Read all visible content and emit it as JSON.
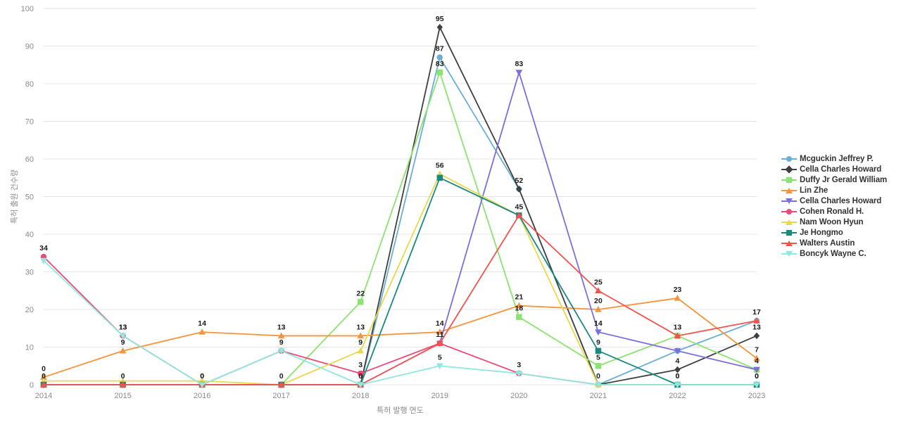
{
  "chart_data": {
    "type": "line",
    "title": "",
    "xlabel": "특허 발행 연도",
    "ylabel": "특허 출원 건수량",
    "categories": [
      "2014",
      "2015",
      "2016",
      "2017",
      "2018",
      "2019",
      "2020",
      "2021",
      "2022",
      "2023"
    ],
    "x": [
      2014,
      2015,
      2016,
      2017,
      2018,
      2019,
      2020,
      2021,
      2022,
      2023
    ],
    "ylim": [
      0,
      100
    ],
    "yticks": [
      0,
      10,
      20,
      30,
      40,
      50,
      60,
      70,
      80,
      90,
      100
    ],
    "grid": true,
    "legend_position": "right",
    "series": [
      {
        "name": "Mcguckin Jeffrey P.",
        "color": "#6BAED6",
        "marker": "circle",
        "values": [
          0,
          0,
          0,
          0,
          0,
          87,
          52,
          0,
          9,
          17
        ],
        "labels": [
          "",
          "",
          "",
          "",
          "",
          "87",
          "52",
          "",
          "",
          "17"
        ]
      },
      {
        "name": "Cella Charles Howard",
        "color": "#3F3F3F",
        "marker": "diamond",
        "values": [
          0,
          0,
          0,
          0,
          0,
          95,
          52,
          0,
          4,
          13
        ],
        "labels": [
          "",
          "",
          "",
          "",
          "",
          "95",
          "",
          "",
          "4",
          "13"
        ]
      },
      {
        "name": "Duffy Jr Gerald William",
        "color": "#8BE370",
        "marker": "square",
        "values": [
          0,
          0,
          0,
          0,
          22,
          83,
          18,
          5,
          13,
          4
        ],
        "labels": [
          "",
          "",
          "",
          "",
          "22",
          "83",
          "18",
          "5",
          "13",
          "4"
        ]
      },
      {
        "name": "Lin Zhe",
        "color": "#F5943B",
        "marker": "triangle",
        "values": [
          2,
          9,
          14,
          13,
          13,
          14,
          21,
          20,
          23,
          7
        ],
        "labels": [
          "0",
          "9",
          "14",
          "13",
          "13",
          "14",
          "21",
          "20",
          "23",
          "7"
        ]
      },
      {
        "name": "Cella Charles Howard",
        "color": "#7B6FE0",
        "marker": "triangle-down",
        "values": [
          0,
          0,
          0,
          0,
          0,
          11,
          83,
          14,
          9,
          4
        ],
        "labels": [
          "",
          "",
          "",
          "",
          "",
          "",
          "83",
          "14",
          "",
          ""
        ]
      },
      {
        "name": "Cohen Ronald H.",
        "color": "#EE4877",
        "marker": "circle",
        "values": [
          34,
          13,
          0,
          9,
          3,
          11,
          3,
          0,
          0,
          0
        ],
        "labels": [
          "34",
          "13",
          "0",
          "9",
          "3",
          "11",
          "3",
          "0",
          "0",
          "0"
        ]
      },
      {
        "name": "Nam Woon Hyun",
        "color": "#E8D84B",
        "marker": "triangle",
        "values": [
          1,
          1,
          1,
          0,
          9,
          56,
          45,
          0,
          0,
          0
        ],
        "labels": [
          "",
          "",
          "",
          "",
          "9",
          "56",
          "",
          "",
          "",
          ""
        ]
      },
      {
        "name": "Je Hongmo",
        "color": "#188A7F",
        "marker": "square",
        "values": [
          0,
          0,
          0,
          0,
          0,
          55,
          45,
          9,
          0,
          0
        ],
        "labels": [
          "0",
          "0",
          "0",
          "0",
          "0",
          "",
          "45",
          "9",
          "0",
          "0"
        ]
      },
      {
        "name": "Walters Austin",
        "color": "#F4534D",
        "marker": "triangle",
        "values": [
          0,
          0,
          0,
          0,
          0,
          11,
          45,
          25,
          13,
          17
        ],
        "labels": [
          "",
          "",
          "",
          "",
          "",
          "",
          "",
          "25",
          "",
          ""
        ]
      },
      {
        "name": "Boncyk Wayne C.",
        "color": "#8EE8DF",
        "marker": "triangle-down",
        "values": [
          33,
          13,
          0,
          9,
          0,
          5,
          3,
          0,
          0,
          0
        ],
        "labels": [
          "",
          "13",
          "",
          "",
          "",
          "5",
          "",
          "",
          "",
          ""
        ]
      }
    ]
  },
  "legend": {
    "items": [
      "Mcguckin Jeffrey P.",
      "Cella Charles Howard",
      "Duffy Jr Gerald William",
      "Lin Zhe",
      "Cella Charles Howard",
      "Cohen Ronald H.",
      "Nam Woon Hyun",
      "Je Hongmo",
      "Walters Austin",
      "Boncyk Wayne C."
    ]
  }
}
